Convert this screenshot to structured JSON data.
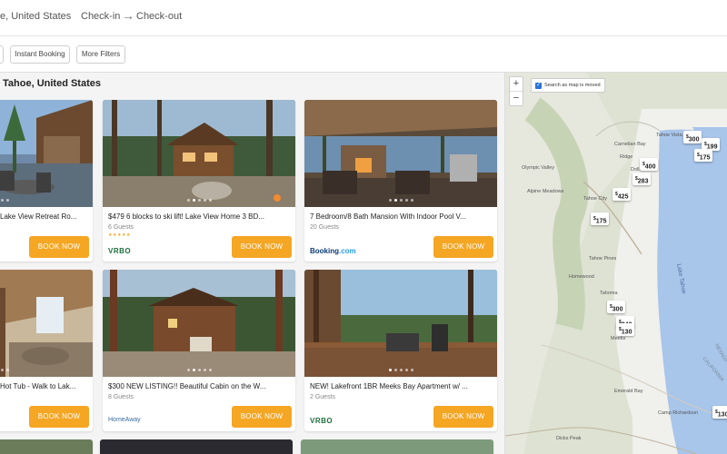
{
  "header": {
    "location": "e, United States",
    "checkin": "Check-in",
    "arrow": "→",
    "checkout": "Check-out"
  },
  "filters": {
    "instant_booking": "Instant Booking",
    "more_filters": "More Filters"
  },
  "results": {
    "title": "Tahoe, United States",
    "book_label": "BOOK NOW",
    "cards": [
      {
        "title": "Lake View Retreat Ro...",
        "guests": "",
        "brand": ""
      },
      {
        "title": "$479 6 blocks to ski lift! Lake View Home 3 BD...",
        "guests": "6 Guests",
        "stars": "★★★★★",
        "brand": "VRBO"
      },
      {
        "title": "7 Bedroom/8 Bath Mansion With Indoor Pool V...",
        "guests": "20 Guests",
        "brand_main": "Booking",
        "brand_tld": ".com"
      },
      {
        "title": "Hot Tub - Walk to Lak...",
        "guests": "",
        "brand": ""
      },
      {
        "title": "$300 NEW LISTING!! Beautiful Cabin on the W...",
        "guests": "8 Guests",
        "brand": "HomeAway"
      },
      {
        "title": "NEW! Lakefront 1BR Meeks Bay Apartment w/ ...",
        "guests": "2 Guests",
        "brand": "VRBO"
      }
    ]
  },
  "map": {
    "zoom_in": "+",
    "zoom_out": "−",
    "search_as_moved": "Search as map is moved",
    "checkmark": "✓",
    "currency": "$",
    "prices": [
      "300",
      "199",
      "175",
      "400",
      "283",
      "425",
      "175",
      "300",
      "240",
      "130",
      "130"
    ],
    "labels": {
      "lake": "Lake Tahoe",
      "olympic_valley": "Olympic Valley",
      "alpine_meadows": "Alpine Meadows",
      "carnelian_bay": "Carnelian Bay",
      "ridgewood": "Ridge",
      "dollar_point": "Dolla",
      "tahoe_city": "Tahoe City",
      "tahoe_vista": "Tahoe Vista",
      "tahoe_pines": "Tahoe Pines",
      "homewood": "Homewood",
      "tahoma": "Tahoma",
      "meeks_bay": "Meeks",
      "emerald_bay": "Emerald Bay",
      "camp_richardson": "Camp Richardson",
      "dicks_peak": "Dicks Peak",
      "state_label": "NEVADA",
      "state_label2": "CALIFORNIA"
    }
  },
  "colors": {
    "accent_button": "#f5a623",
    "checkbox": "#2b73d8",
    "lake": "#a8c5ea",
    "forest": "#c5d6b4"
  }
}
